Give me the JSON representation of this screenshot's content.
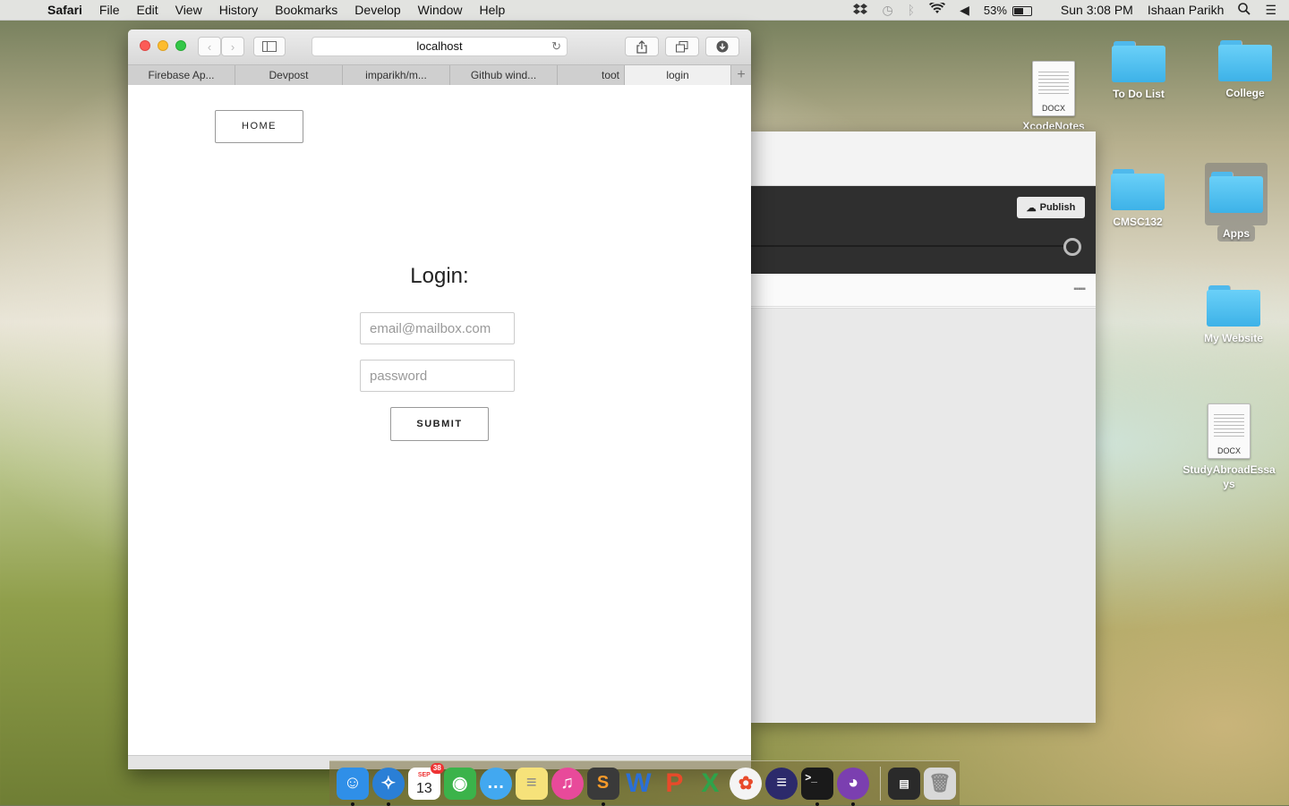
{
  "menubar": {
    "app_name": "Safari",
    "items": [
      "File",
      "Edit",
      "View",
      "History",
      "Bookmarks",
      "Develop",
      "Window",
      "Help"
    ],
    "battery": "53%",
    "battery_level": 0.53,
    "clock": "Sun 3:08 PM",
    "user": "Ishaan Parikh"
  },
  "desktop": {
    "icons": [
      {
        "label": "XcodeNotes",
        "type": "docx",
        "badge": "DOCX"
      },
      {
        "label": "To Do List",
        "type": "folder"
      },
      {
        "label": "College",
        "type": "folder"
      },
      {
        "label": "CMSC132",
        "type": "folder"
      },
      {
        "label": "Apps",
        "type": "folder"
      },
      {
        "label": "My Website",
        "type": "folder"
      },
      {
        "label": "StudyAbroadEssays",
        "type": "docx",
        "badge": "DOCX"
      }
    ]
  },
  "background_window": {
    "publish_label": "Publish"
  },
  "safari": {
    "address": "localhost",
    "tabs": [
      "Firebase Ap...",
      "Devpost",
      "imparikh/m...",
      "Github wind...",
      "toot",
      "login"
    ],
    "active_tab": "login"
  },
  "page": {
    "home_label": "HOME",
    "login_title": "Login:",
    "email_placeholder": "email@mailbox.com",
    "password_placeholder": "password",
    "submit_label": "SUBMIT"
  },
  "dock": {
    "calendar_month": "SEP",
    "calendar_day": "13",
    "calendar_badge": "38",
    "apps": [
      {
        "name": "finder",
        "color": "#2f8fe8"
      },
      {
        "name": "safari",
        "color": "#2a7fd6"
      },
      {
        "name": "calendar",
        "color": "#ffffff"
      },
      {
        "name": "facetime",
        "color": "#3bb34a"
      },
      {
        "name": "messages",
        "color": "#42a8f0"
      },
      {
        "name": "notes",
        "color": "#f6e27a"
      },
      {
        "name": "itunes",
        "color": "#e84a9a"
      },
      {
        "name": "sublime",
        "color": "#3a3a3a"
      },
      {
        "name": "word",
        "color": "#2b6fd6"
      },
      {
        "name": "powerpoint",
        "color": "#e84a2a"
      },
      {
        "name": "excel",
        "color": "#2ea34a"
      },
      {
        "name": "photos",
        "color": "#f4f4f4"
      },
      {
        "name": "eclipse",
        "color": "#2c2a6b"
      },
      {
        "name": "terminal",
        "color": "#1a1a1a"
      },
      {
        "name": "github-desktop",
        "color": "#7b3fb0"
      },
      {
        "name": "activity-monitor",
        "color": "#2a2a2a"
      },
      {
        "name": "trash",
        "color": "#d8d8d8"
      }
    ]
  }
}
